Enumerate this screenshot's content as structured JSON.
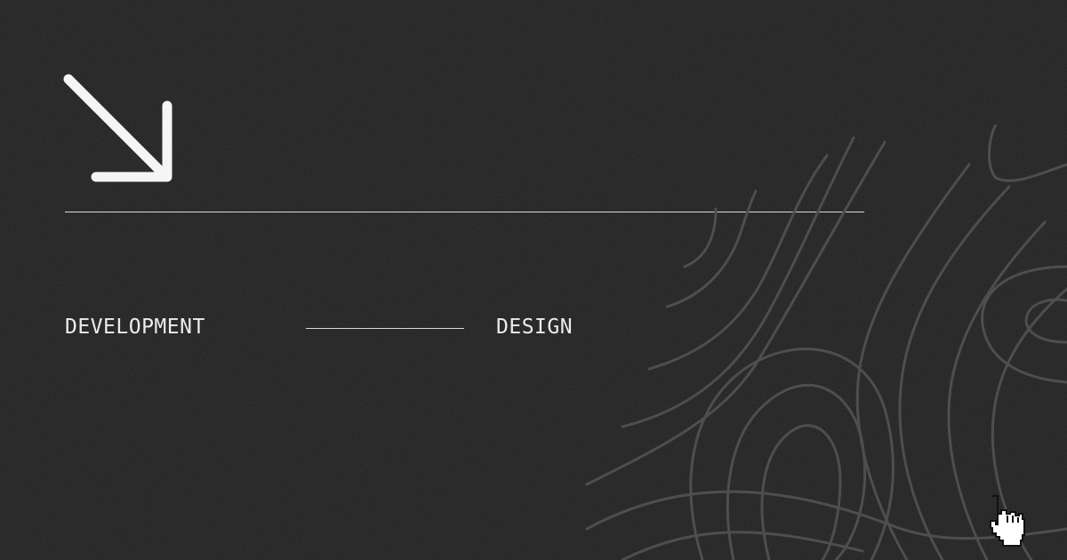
{
  "labels": {
    "left": "DEVELOPMENT",
    "right": "DESIGN"
  },
  "icons": {
    "arrow": "arrow-down-right-icon",
    "cursor": "hand-pointer-cursor-icon",
    "pattern": "topographic-contour-pattern"
  },
  "colors": {
    "background": "#1f1f1f",
    "foreground": "#ececec",
    "contour": "#505050"
  }
}
